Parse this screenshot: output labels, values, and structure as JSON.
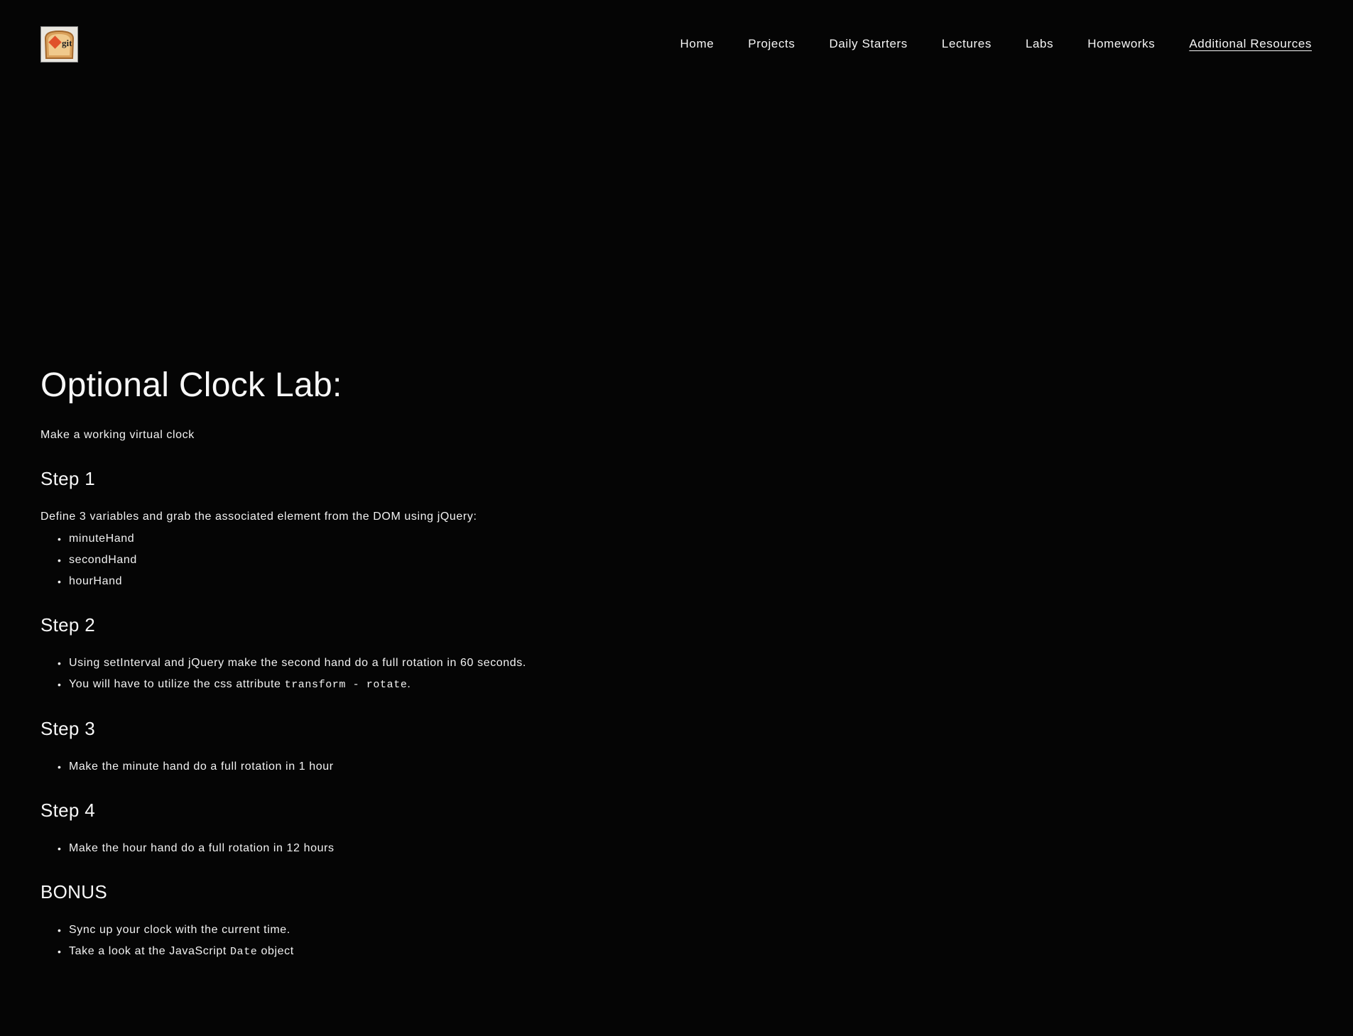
{
  "header": {
    "logo_label": "git",
    "nav": [
      {
        "label": "Home",
        "active": false
      },
      {
        "label": "Projects",
        "active": false
      },
      {
        "label": "Daily Starters",
        "active": false
      },
      {
        "label": "Lectures",
        "active": false
      },
      {
        "label": "Labs",
        "active": false
      },
      {
        "label": "Homeworks",
        "active": false
      },
      {
        "label": "Additional Resources",
        "active": true
      }
    ]
  },
  "main": {
    "title": "Optional Clock Lab:",
    "intro": "Make a working virtual clock",
    "step1": {
      "heading": "Step 1",
      "text": "Define 3 variables and grab the associated element from the DOM using jQuery:",
      "items": [
        "minuteHand",
        "secondHand",
        "hourHand"
      ]
    },
    "step2": {
      "heading": "Step 2",
      "item1": "Using setInterval and jQuery make the second hand do a full rotation in 60 seconds.",
      "item2_before": "You will have to utilize the css attribute ",
      "item2_code": "transform - rotate",
      "item2_after": "."
    },
    "step3": {
      "heading": "Step 3",
      "item1": "Make the minute hand do a full rotation in 1 hour"
    },
    "step4": {
      "heading": "Step 4",
      "item1": "Make the hour hand do a full rotation in 12 hours"
    },
    "bonus": {
      "heading": "BONUS",
      "item1": "Sync up your clock with the current time.",
      "item2_before": "Take a look at the JavaScript ",
      "item2_code": "Date",
      "item2_after": " object"
    }
  },
  "colors": {
    "background": "#050505",
    "text": "#f2f2f2",
    "logo_accent": "#e0502a"
  }
}
